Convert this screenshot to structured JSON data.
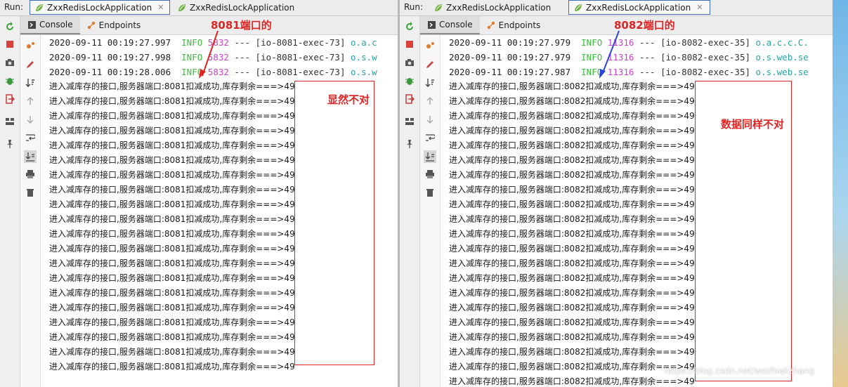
{
  "run_label": "Run:",
  "tab_title": "ZxxRedisLockApplication",
  "subtabs": [
    "Console",
    "Endpoints"
  ],
  "colors": {
    "annotation": "#e02424",
    "arrow_left": "#e02424",
    "arrow_right": "#2b45d8",
    "info": "#3cbb3c",
    "pid": "#c843c8",
    "class": "#27a3a8",
    "active_tab_border": "#3d6ec2"
  },
  "left": {
    "annotation_title": "8081端口的",
    "annotation_note": "显然不对",
    "log": [
      {
        "ts": "2020-09-11 00:19:27.997",
        "level": "INFO",
        "pid": "5832",
        "dash": "---",
        "thread": "[io-8081-exec-73]",
        "cls": "o.a.c"
      },
      {
        "ts": "2020-09-11 00:19:27.998",
        "level": "INFO",
        "pid": "5832",
        "dash": "---",
        "thread": "[io-8081-exec-73]",
        "cls": "o.s.w"
      },
      {
        "ts": "2020-09-11 00:19:28.006",
        "level": "INFO",
        "pid": "5832",
        "dash": "---",
        "thread": "[io-8081-exec-73]",
        "cls": "o.s.w"
      }
    ],
    "message": "进入减库存的接口,服务器端口:8081扣减成功,库存剩余===>49",
    "message_last": "进入减库存的接口,服务器端口:8081扣减成功,库存剩余===>49"
  },
  "right": {
    "annotation_title": "8082端口的",
    "annotation_note": "数据同样不对",
    "log": [
      {
        "ts": "2020-09-11 00:19:27.979",
        "level": "INFO",
        "pid": "11316",
        "dash": "---",
        "thread": "[io-8082-exec-35]",
        "cls": "o.a.c.c.C."
      },
      {
        "ts": "2020-09-11 00:19:27.979",
        "level": "INFO",
        "pid": "11316",
        "dash": "---",
        "thread": "[io-8082-exec-35]",
        "cls": "o.s.web.se"
      },
      {
        "ts": "2020-09-11 00:19:27.987",
        "level": "INFO",
        "pid": "11316",
        "dash": "---",
        "thread": "[io-8082-exec-35]",
        "cls": "o.s.web.se"
      }
    ],
    "message": "进入减库存的接口,服务器端口:8082扣减成功,库存剩余===>49"
  },
  "watermark": "https://blog.csdn.net/wozhiakzhang"
}
